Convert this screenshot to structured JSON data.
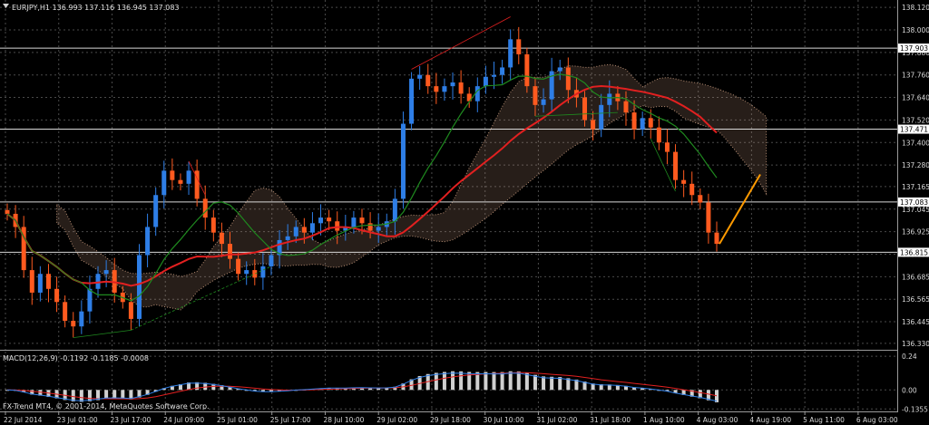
{
  "chart_data": [
    {
      "type": "candlestick",
      "title": "EURJPY,H1  136.993 137.116 136.945 137.083",
      "symbol": "EURJPY",
      "timeframe": "H1",
      "ohlc_current": {
        "open": 136.993,
        "high": 137.116,
        "low": 136.945,
        "close": 137.083
      },
      "y_ticks": [
        138.12,
        138.0,
        137.88,
        137.76,
        137.64,
        137.52,
        137.4,
        137.28,
        137.165,
        137.045,
        136.925,
        136.805,
        136.685,
        136.565,
        136.445,
        136.33
      ],
      "y_tick_labels": [
        "138.120",
        "138.000",
        "137.880",
        "137.760",
        "137.640",
        "137.520",
        "137.400",
        "137.280",
        "137.165",
        "137.045",
        "136.925",
        "136.805",
        "136.685",
        "136.565",
        "136.445",
        "136.330"
      ],
      "ylim": [
        136.31,
        138.14
      ],
      "horizontal_levels": [
        {
          "value": 137.903,
          "label": "137.903"
        },
        {
          "value": 137.471,
          "label": "137.471"
        },
        {
          "value": 137.083,
          "label": "137.083"
        },
        {
          "value": 136.815,
          "label": "136.815"
        }
      ],
      "x_tick_labels": [
        "22 Jul 2014",
        "23 Jul 01:00",
        "23 Jul 17:00",
        "24 Jul 09:00",
        "25 Jul 01:00",
        "25 Jul 17:00",
        "28 Jul 10:00",
        "29 Jul 02:00",
        "29 Jul 18:00",
        "30 Jul 10:00",
        "31 Jul 02:00",
        "31 Jul 18:00",
        "1 Aug 10:00",
        "4 Aug 03:00",
        "4 Aug 19:00",
        "5 Aug 11:00",
        "6 Aug 03:00"
      ],
      "grid": true,
      "closes": [
        137.02,
        136.95,
        136.72,
        136.6,
        136.7,
        136.62,
        136.55,
        136.45,
        136.42,
        136.5,
        136.62,
        136.7,
        136.72,
        136.6,
        136.55,
        136.46,
        136.8,
        136.95,
        137.12,
        137.25,
        137.2,
        137.18,
        137.25,
        137.1,
        137.0,
        136.92,
        136.86,
        136.78,
        136.7,
        136.72,
        136.68,
        136.74,
        136.8,
        136.88,
        136.9,
        136.95,
        136.92,
        136.97,
        137.0,
        136.98,
        136.93,
        136.95,
        137.0,
        136.97,
        136.93,
        136.95,
        136.98,
        137.1,
        137.5,
        137.74,
        137.76,
        137.7,
        137.67,
        137.7,
        137.72,
        137.66,
        137.62,
        137.7,
        137.75,
        137.76,
        137.8,
        137.95,
        137.87,
        137.7,
        137.6,
        137.63,
        137.78,
        137.8,
        137.68,
        137.64,
        137.52,
        137.47,
        137.6,
        137.66,
        137.62,
        137.56,
        137.47,
        137.53,
        137.48,
        137.4,
        137.35,
        137.2,
        137.18,
        137.12,
        137.08,
        136.92,
        136.86
      ],
      "projection": {
        "from": 136.86,
        "to": 137.23
      }
    },
    {
      "type": "histogram",
      "title": "MACD(12,26,9) -0.1192 -0.1185 -0.0008",
      "indicator": "MACD(12,26,9)",
      "values_current": [
        -0.1192,
        -0.1185,
        -0.0008
      ],
      "y_ticks": [
        0.24,
        0.0,
        -0.1355
      ],
      "y_tick_labels": [
        "0.24",
        "0.00",
        "-0.1355"
      ],
      "ylim": [
        -0.14,
        0.26
      ]
    }
  ],
  "footer": {
    "copyright": "FX-Trend MT4, © 2001-2014, MetaQuotes Software Corp."
  },
  "colors": {
    "background": "#000000",
    "grid": "#4a4a4a",
    "bull": "#2e7ee6",
    "bear": "#ff5a1f",
    "ma_red": "#e22020",
    "ma_green": "#1f8a1f",
    "cloud": "#d8a888",
    "projection": "#ff9a00"
  }
}
